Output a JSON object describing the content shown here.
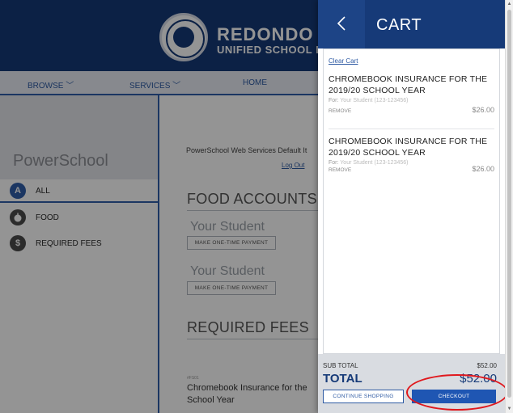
{
  "header": {
    "brand_line1": "REDONDO BE",
    "brand_line2": "UNIFIED SCHOOL DIS"
  },
  "nav": {
    "browse": "BROWSE ﹀",
    "services": "SERVICES ﹀",
    "home": "HOME"
  },
  "sidebar": {
    "title": "PowerSchool",
    "items": [
      {
        "label": "ALL",
        "icon": "A"
      },
      {
        "label": "FOOD",
        "icon": "food-icon"
      },
      {
        "label": "REQUIRED FEES",
        "icon": "$"
      }
    ]
  },
  "main": {
    "default_text": "PowerSchool Web Services Default It",
    "logout": "Log Out",
    "food_title": "FOOD ACCOUNTS",
    "students": [
      "Your Student",
      "Your Student"
    ],
    "pay_button": "MAKE ONE-TIME PAYMENT",
    "fees_title": "REQUIRED FEES",
    "fee_id": "#FS01",
    "fee_name": "Chromebook Insurance for the School Year"
  },
  "cart": {
    "back_icon": "chevron-left-icon",
    "title": "CART",
    "clear_cart": "Clear Cart",
    "items": [
      {
        "name": "CHROMEBOOK INSURANCE FOR THE 2019/20 SCHOOL YEAR",
        "for_label": "For:",
        "for_value": "Your Student (123-123456)",
        "remove": "REMOVE",
        "price": "$26.00"
      },
      {
        "name": "CHROMEBOOK INSURANCE FOR THE 2019/20 SCHOOL YEAR",
        "for_label": "For:",
        "for_value": "Your Student (123-123456)",
        "remove": "REMOVE",
        "price": "$26.00"
      }
    ],
    "subtotal_label": "SUB TOTAL",
    "subtotal_value": "$52.00",
    "total_label": "TOTAL",
    "total_value": "$52.00",
    "continue_button": "CONTINUE SHOPPING",
    "checkout_button": "CHECKOUT"
  },
  "colors": {
    "brand_navy": "#163a78",
    "accent_blue": "#1f56b3",
    "annotation_red": "#e0191e"
  }
}
